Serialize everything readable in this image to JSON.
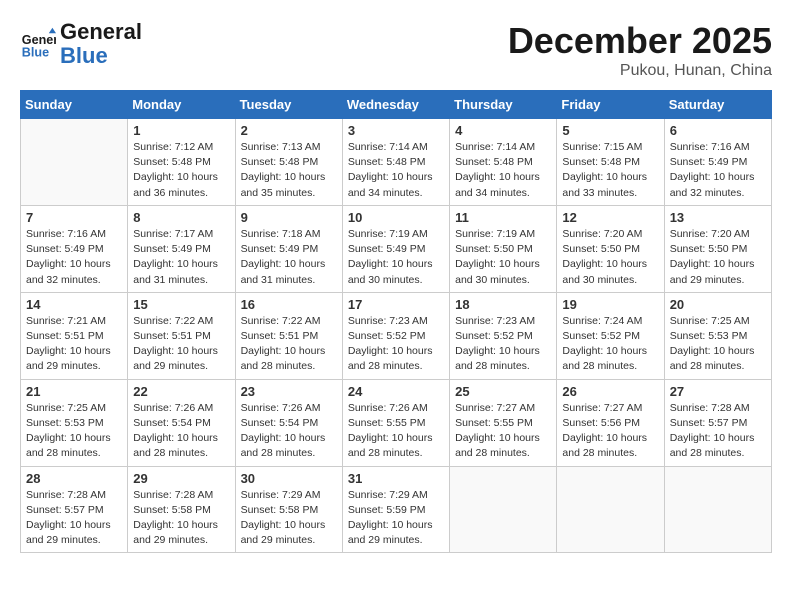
{
  "header": {
    "logo_line1": "General",
    "logo_line2": "Blue",
    "month": "December 2025",
    "location": "Pukou, Hunan, China"
  },
  "weekdays": [
    "Sunday",
    "Monday",
    "Tuesday",
    "Wednesday",
    "Thursday",
    "Friday",
    "Saturday"
  ],
  "weeks": [
    [
      {
        "day": "",
        "info": ""
      },
      {
        "day": "1",
        "info": "Sunrise: 7:12 AM\nSunset: 5:48 PM\nDaylight: 10 hours\nand 36 minutes."
      },
      {
        "day": "2",
        "info": "Sunrise: 7:13 AM\nSunset: 5:48 PM\nDaylight: 10 hours\nand 35 minutes."
      },
      {
        "day": "3",
        "info": "Sunrise: 7:14 AM\nSunset: 5:48 PM\nDaylight: 10 hours\nand 34 minutes."
      },
      {
        "day": "4",
        "info": "Sunrise: 7:14 AM\nSunset: 5:48 PM\nDaylight: 10 hours\nand 34 minutes."
      },
      {
        "day": "5",
        "info": "Sunrise: 7:15 AM\nSunset: 5:48 PM\nDaylight: 10 hours\nand 33 minutes."
      },
      {
        "day": "6",
        "info": "Sunrise: 7:16 AM\nSunset: 5:49 PM\nDaylight: 10 hours\nand 32 minutes."
      }
    ],
    [
      {
        "day": "7",
        "info": "Sunrise: 7:16 AM\nSunset: 5:49 PM\nDaylight: 10 hours\nand 32 minutes."
      },
      {
        "day": "8",
        "info": "Sunrise: 7:17 AM\nSunset: 5:49 PM\nDaylight: 10 hours\nand 31 minutes."
      },
      {
        "day": "9",
        "info": "Sunrise: 7:18 AM\nSunset: 5:49 PM\nDaylight: 10 hours\nand 31 minutes."
      },
      {
        "day": "10",
        "info": "Sunrise: 7:19 AM\nSunset: 5:49 PM\nDaylight: 10 hours\nand 30 minutes."
      },
      {
        "day": "11",
        "info": "Sunrise: 7:19 AM\nSunset: 5:50 PM\nDaylight: 10 hours\nand 30 minutes."
      },
      {
        "day": "12",
        "info": "Sunrise: 7:20 AM\nSunset: 5:50 PM\nDaylight: 10 hours\nand 30 minutes."
      },
      {
        "day": "13",
        "info": "Sunrise: 7:20 AM\nSunset: 5:50 PM\nDaylight: 10 hours\nand 29 minutes."
      }
    ],
    [
      {
        "day": "14",
        "info": "Sunrise: 7:21 AM\nSunset: 5:51 PM\nDaylight: 10 hours\nand 29 minutes."
      },
      {
        "day": "15",
        "info": "Sunrise: 7:22 AM\nSunset: 5:51 PM\nDaylight: 10 hours\nand 29 minutes."
      },
      {
        "day": "16",
        "info": "Sunrise: 7:22 AM\nSunset: 5:51 PM\nDaylight: 10 hours\nand 28 minutes."
      },
      {
        "day": "17",
        "info": "Sunrise: 7:23 AM\nSunset: 5:52 PM\nDaylight: 10 hours\nand 28 minutes."
      },
      {
        "day": "18",
        "info": "Sunrise: 7:23 AM\nSunset: 5:52 PM\nDaylight: 10 hours\nand 28 minutes."
      },
      {
        "day": "19",
        "info": "Sunrise: 7:24 AM\nSunset: 5:52 PM\nDaylight: 10 hours\nand 28 minutes."
      },
      {
        "day": "20",
        "info": "Sunrise: 7:25 AM\nSunset: 5:53 PM\nDaylight: 10 hours\nand 28 minutes."
      }
    ],
    [
      {
        "day": "21",
        "info": "Sunrise: 7:25 AM\nSunset: 5:53 PM\nDaylight: 10 hours\nand 28 minutes."
      },
      {
        "day": "22",
        "info": "Sunrise: 7:26 AM\nSunset: 5:54 PM\nDaylight: 10 hours\nand 28 minutes."
      },
      {
        "day": "23",
        "info": "Sunrise: 7:26 AM\nSunset: 5:54 PM\nDaylight: 10 hours\nand 28 minutes."
      },
      {
        "day": "24",
        "info": "Sunrise: 7:26 AM\nSunset: 5:55 PM\nDaylight: 10 hours\nand 28 minutes."
      },
      {
        "day": "25",
        "info": "Sunrise: 7:27 AM\nSunset: 5:55 PM\nDaylight: 10 hours\nand 28 minutes."
      },
      {
        "day": "26",
        "info": "Sunrise: 7:27 AM\nSunset: 5:56 PM\nDaylight: 10 hours\nand 28 minutes."
      },
      {
        "day": "27",
        "info": "Sunrise: 7:28 AM\nSunset: 5:57 PM\nDaylight: 10 hours\nand 28 minutes."
      }
    ],
    [
      {
        "day": "28",
        "info": "Sunrise: 7:28 AM\nSunset: 5:57 PM\nDaylight: 10 hours\nand 29 minutes."
      },
      {
        "day": "29",
        "info": "Sunrise: 7:28 AM\nSunset: 5:58 PM\nDaylight: 10 hours\nand 29 minutes."
      },
      {
        "day": "30",
        "info": "Sunrise: 7:29 AM\nSunset: 5:58 PM\nDaylight: 10 hours\nand 29 minutes."
      },
      {
        "day": "31",
        "info": "Sunrise: 7:29 AM\nSunset: 5:59 PM\nDaylight: 10 hours\nand 29 minutes."
      },
      {
        "day": "",
        "info": ""
      },
      {
        "day": "",
        "info": ""
      },
      {
        "day": "",
        "info": ""
      }
    ]
  ]
}
